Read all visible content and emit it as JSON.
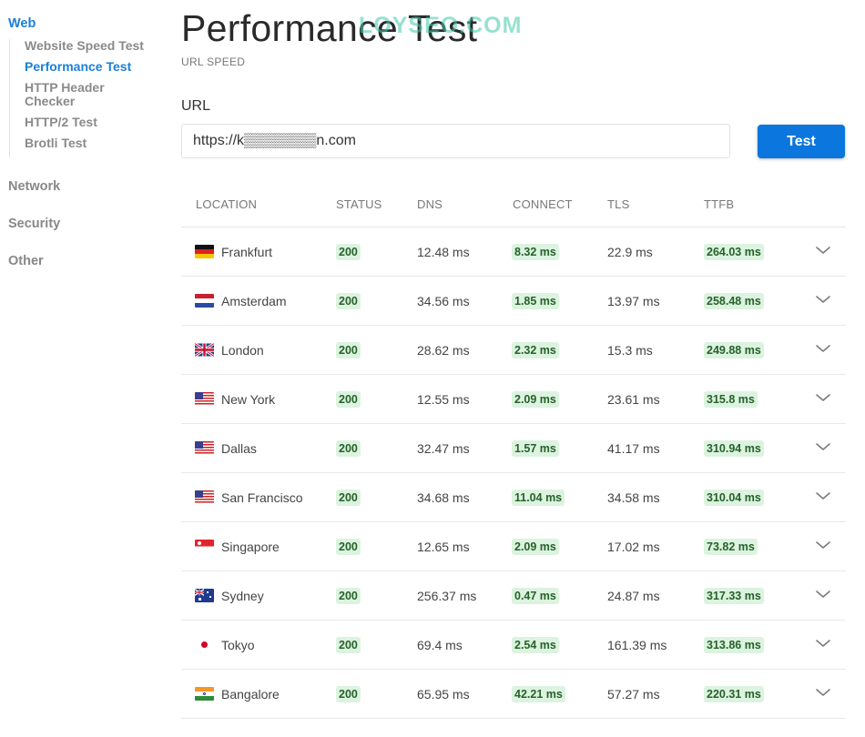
{
  "sidebar": {
    "web": "Web",
    "web_items": [
      "Website Speed Test",
      "Performance Test",
      "HTTP Header Checker",
      "HTTP/2 Test",
      "Brotli Test"
    ],
    "network": "Network",
    "security": "Security",
    "other": "Other"
  },
  "header": {
    "title": "Performance Test",
    "watermark": "LOYSEO.COM",
    "subtitle": "URL SPEED"
  },
  "form": {
    "url_label": "URL",
    "url_value": "https://k▒▒▒▒▒▒▒n.com",
    "button": "Test"
  },
  "table": {
    "columns": [
      "LOCATION",
      "STATUS",
      "DNS",
      "CONNECT",
      "TLS",
      "TTFB"
    ],
    "rows": [
      {
        "flag": "de",
        "location": "Frankfurt",
        "status": "200",
        "dns": "12.48 ms",
        "connect": "8.32 ms",
        "tls": "22.9 ms",
        "ttfb": "264.03 ms"
      },
      {
        "flag": "nl",
        "location": "Amsterdam",
        "status": "200",
        "dns": "34.56 ms",
        "connect": "1.85 ms",
        "tls": "13.97 ms",
        "ttfb": "258.48 ms"
      },
      {
        "flag": "gb",
        "location": "London",
        "status": "200",
        "dns": "28.62 ms",
        "connect": "2.32 ms",
        "tls": "15.3 ms",
        "ttfb": "249.88 ms"
      },
      {
        "flag": "us",
        "location": "New York",
        "status": "200",
        "dns": "12.55 ms",
        "connect": "2.09 ms",
        "tls": "23.61 ms",
        "ttfb": "315.8 ms"
      },
      {
        "flag": "us",
        "location": "Dallas",
        "status": "200",
        "dns": "32.47 ms",
        "connect": "1.57 ms",
        "tls": "41.17 ms",
        "ttfb": "310.94 ms"
      },
      {
        "flag": "us",
        "location": "San Francisco",
        "status": "200",
        "dns": "34.68 ms",
        "connect": "11.04 ms",
        "tls": "34.58 ms",
        "ttfb": "310.04 ms"
      },
      {
        "flag": "sg",
        "location": "Singapore",
        "status": "200",
        "dns": "12.65 ms",
        "connect": "2.09 ms",
        "tls": "17.02 ms",
        "ttfb": "73.82 ms"
      },
      {
        "flag": "au",
        "location": "Sydney",
        "status": "200",
        "dns": "256.37 ms",
        "connect": "0.47 ms",
        "tls": "24.87 ms",
        "ttfb": "317.33 ms"
      },
      {
        "flag": "jp",
        "location": "Tokyo",
        "status": "200",
        "dns": "69.4 ms",
        "connect": "2.54 ms",
        "tls": "161.39 ms",
        "ttfb": "313.86 ms"
      },
      {
        "flag": "in",
        "location": "Bangalore",
        "status": "200",
        "dns": "65.95 ms",
        "connect": "42.21 ms",
        "tls": "57.27 ms",
        "ttfb": "220.31 ms"
      }
    ]
  },
  "colors": {
    "accent": "#1a7fd9",
    "button": "#0a76de",
    "badge_bg": "#dcf3df",
    "badge_text": "#26612b"
  },
  "icons": {
    "expand": "chevron-down-icon"
  }
}
